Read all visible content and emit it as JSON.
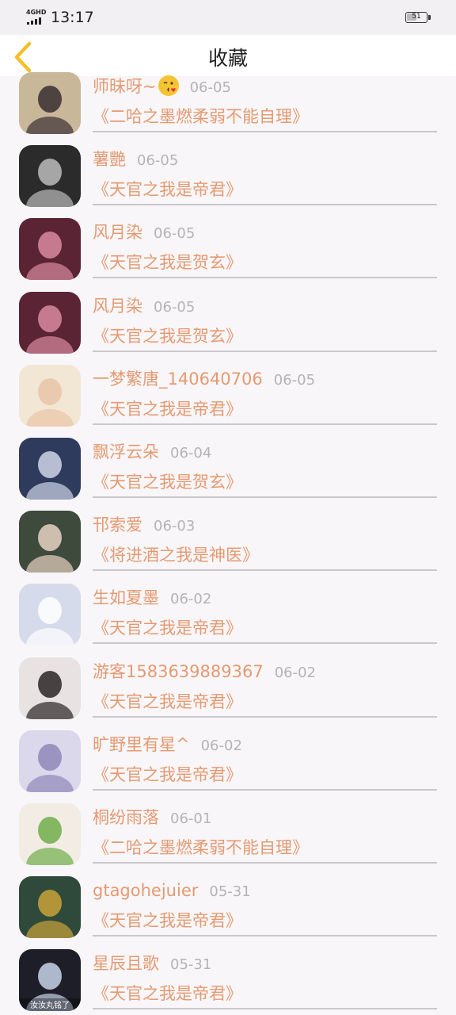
{
  "status_bar": {
    "network": "4GHD",
    "time": "13:17",
    "battery": "51"
  },
  "header": {
    "title": "收藏",
    "back_icon": "chevron-left-icon"
  },
  "items": [
    {
      "name": "师昧呀~",
      "date": "06-05",
      "title": "《二哈之墨燃柔弱不能自理》",
      "emoji": "kiss-emoji-icon",
      "avatar_colors": [
        "#c9b79a",
        "#3a2f33"
      ]
    },
    {
      "name": "薯艷",
      "date": "06-05",
      "title": "《天官之我是帝君》",
      "avatar_colors": [
        "#2b2b2b",
        "#bcbcbc"
      ]
    },
    {
      "name": "风月染",
      "date": "06-05",
      "title": "《天官之我是贺玄》",
      "avatar_colors": [
        "#5a2434",
        "#d88aa0"
      ]
    },
    {
      "name": "风月染",
      "date": "06-05",
      "title": "《天官之我是贺玄》",
      "avatar_colors": [
        "#5a2434",
        "#d88aa0"
      ]
    },
    {
      "name": "一梦繁唐_140640706",
      "date": "06-05",
      "title": "《天官之我是帝君》",
      "avatar_colors": [
        "#f2e6d4",
        "#e9c4a8"
      ]
    },
    {
      "name": "飘浮云朵",
      "date": "06-04",
      "title": "《天官之我是贺玄》",
      "avatar_colors": [
        "#2e3b5c",
        "#cfd6e8"
      ]
    },
    {
      "name": "邗索爱",
      "date": "06-03",
      "title": "《将进酒之我是神医》",
      "avatar_colors": [
        "#3d4a3c",
        "#e8d2c2"
      ]
    },
    {
      "name": "生如夏墨",
      "date": "06-02",
      "title": "《天官之我是帝君》",
      "avatar_colors": [
        "#d6dbeb",
        "#ffffff"
      ]
    },
    {
      "name": "游客1583639889367",
      "date": "06-02",
      "title": "《天官之我是帝君》",
      "avatar_colors": [
        "#e8e2e2",
        "#2b2424"
      ]
    },
    {
      "name": "旷野里有星^",
      "date": "06-02",
      "title": "《天官之我是帝君》",
      "avatar_colors": [
        "#dcd8ec",
        "#8f88b8"
      ]
    },
    {
      "name": "桐纷雨落",
      "date": "06-01",
      "title": "《二哈之墨燃柔弱不能自理》",
      "avatar_colors": [
        "#f3ece4",
        "#6fae4a"
      ]
    },
    {
      "name": "gtagohejuier",
      "date": "05-31",
      "title": "《天官之我是帝君》",
      "avatar_colors": [
        "#2f4a3a",
        "#c9a23a"
      ]
    },
    {
      "name": "星辰且歌",
      "date": "05-31",
      "title": "《天官之我是帝君》",
      "avatar_caption": "汝汝丸铭了",
      "avatar_colors": [
        "#1e1e28",
        "#c8d4e8"
      ]
    }
  ]
}
